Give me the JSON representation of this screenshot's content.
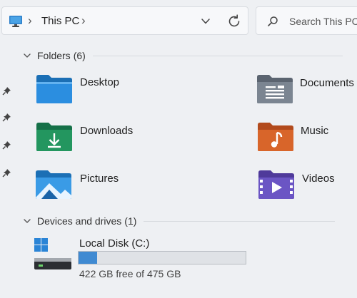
{
  "address_bar": {
    "location_icon": "this-pc-icon",
    "breadcrumb": "This PC",
    "separator": "›"
  },
  "search": {
    "placeholder": "Search This PC"
  },
  "groups": {
    "folders": {
      "title": "Folders",
      "count": "(6)"
    },
    "devices": {
      "title": "Devices and drives",
      "count": "(1)"
    }
  },
  "folders": [
    {
      "name": "Desktop",
      "icon": "desktop-folder-icon"
    },
    {
      "name": "Documents",
      "icon": "documents-folder-icon"
    },
    {
      "name": "Downloads",
      "icon": "downloads-folder-icon"
    },
    {
      "name": "Music",
      "icon": "music-folder-icon"
    },
    {
      "name": "Pictures",
      "icon": "pictures-folder-icon"
    },
    {
      "name": "Videos",
      "icon": "videos-folder-icon"
    }
  ],
  "drive": {
    "name": "Local Disk (C:)",
    "free_text": "422 GB free of 475 GB",
    "used_fraction": 0.112,
    "icon": "windows-drive-icon"
  },
  "colors": {
    "accent": "#0a6fc2",
    "drive_fill": "#3f8ad2",
    "background": "#eef0f3"
  }
}
